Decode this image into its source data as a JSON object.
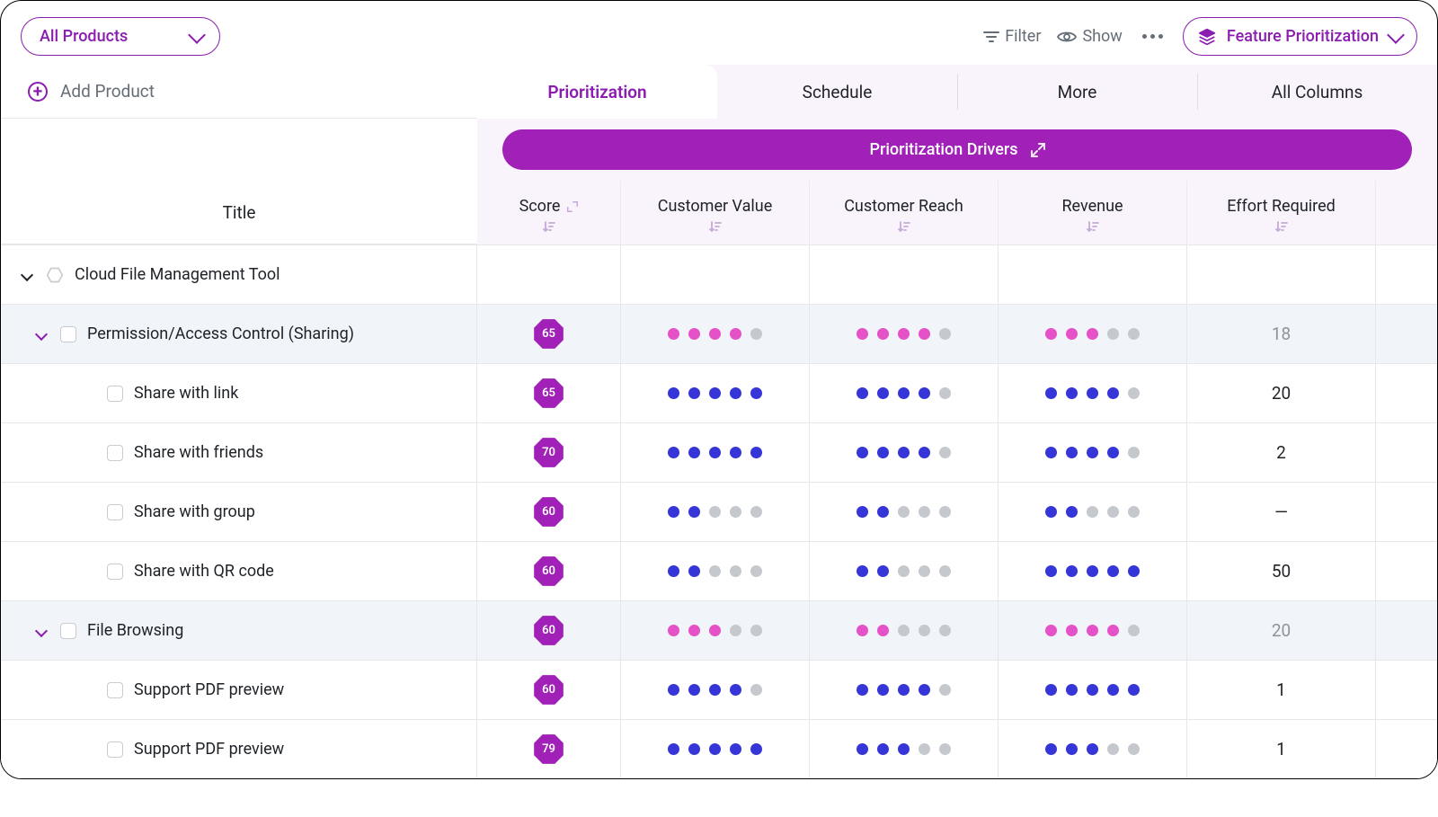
{
  "topbar": {
    "product_selector": "All Products",
    "filter": "Filter",
    "show": "Show",
    "view_label": "Feature Prioritization"
  },
  "add_product": "Add Product",
  "tabs": [
    "Prioritization",
    "Schedule",
    "More",
    "All Columns"
  ],
  "active_tab": 0,
  "drivers_button": "Prioritization Drivers",
  "columns": {
    "title": "Title",
    "score": "Score",
    "drivers": [
      "Customer Value",
      "Customer Reach",
      "Revenue"
    ],
    "effort": "Effort Required"
  },
  "products": [
    {
      "name": "Cloud File Management Tool",
      "groups": [
        {
          "name": "Permission/Access Control (Sharing)",
          "score": 65,
          "drivers": [
            4,
            4,
            3
          ],
          "effort": "18",
          "dot_color": "pink",
          "items": [
            {
              "name": "Share with link",
              "score": 65,
              "drivers": [
                5,
                4,
                4
              ],
              "effort": "20"
            },
            {
              "name": "Share with friends",
              "score": 70,
              "drivers": [
                5,
                4,
                4
              ],
              "effort": "2"
            },
            {
              "name": "Share with group",
              "score": 60,
              "drivers": [
                2,
                2,
                2
              ],
              "effort": "—"
            },
            {
              "name": "Share with QR code",
              "score": 60,
              "drivers": [
                2,
                2,
                5
              ],
              "effort": "50"
            }
          ]
        },
        {
          "name": "File Browsing",
          "score": 60,
          "drivers": [
            3,
            2,
            4
          ],
          "effort": "20",
          "dot_color": "pink",
          "items": [
            {
              "name": "Support PDF preview",
              "score": 60,
              "drivers": [
                4,
                4,
                5
              ],
              "effort": "1"
            },
            {
              "name": "Support PDF preview",
              "score": 79,
              "drivers": [
                5,
                3,
                3
              ],
              "effort": "1"
            }
          ]
        }
      ]
    }
  ]
}
